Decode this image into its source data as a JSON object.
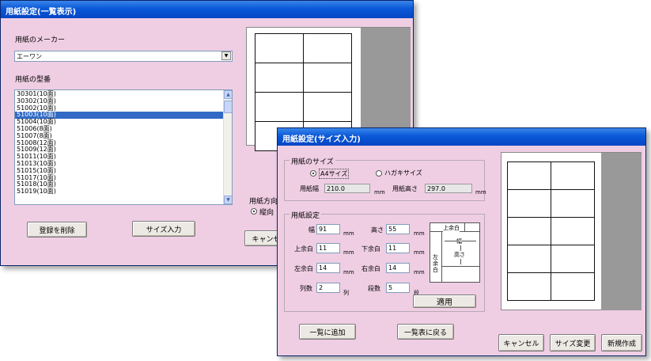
{
  "list_window": {
    "title": "用紙設定(一覧表示)",
    "maker_label": "用紙のメーカー",
    "maker_value": "エーワン",
    "model_label": "用紙の型番",
    "models": [
      "30301(10面)",
      "30302(10面)",
      "51002(10面)",
      "51003(10面)",
      "51004(10面)",
      "51006(8面)",
      "51007(8面)",
      "51008(12面)",
      "51009(12面)",
      "51011(10面)",
      "51013(10面)",
      "51015(10面)",
      "51017(10面)",
      "51018(10面)",
      "51019(10面)"
    ],
    "selected_model": "51003(10面)",
    "delete_button": "登録を削除",
    "size_input_button": "サイズ入力",
    "orientation_label": "用紙方向",
    "orientation_value": "縦向",
    "cancel_button": "キャンセル"
  },
  "size_window": {
    "title": "用紙設定(サイズ入力)",
    "paper_size_group": "用紙のサイズ",
    "radio_a4": "A4サイズ",
    "radio_hagaki": "ハガキサイズ",
    "paper_width_label": "用紙幅",
    "paper_width_value": "210.0",
    "paper_height_label": "用紙高さ",
    "paper_height_value": "297.0",
    "unit_mm": "mm",
    "settings_group": "用紙設定",
    "width_label": "幅",
    "width_value": "91",
    "height_label": "高さ",
    "height_value": "55",
    "top_margin_label": "上余白",
    "top_margin_value": "11",
    "bottom_margin_label": "下余白",
    "bottom_margin_value": "11",
    "left_margin_label": "左余白",
    "left_margin_value": "14",
    "right_margin_label": "右余白",
    "right_margin_value": "14",
    "columns_label": "列数",
    "columns_value": "2",
    "columns_unit": "列",
    "rows_label": "段数",
    "rows_value": "5",
    "rows_unit": "段",
    "diagram": {
      "top": "上余白",
      "width": "幅",
      "height": "高さ",
      "left_1": "左",
      "left_2": "余",
      "left_3": "白"
    },
    "apply_button": "適用",
    "add_to_list_button": "一覧に追加",
    "back_to_list_button": "一覧表に戻る",
    "cancel_button": "キャンセル",
    "change_size_button": "サイズ変更",
    "new_button": "新規作成"
  },
  "colors": {
    "title_bar": "#0a58d8",
    "dialog_bg": "#efcee4",
    "selection": "#316ac5"
  },
  "icons": {
    "dropdown": "chevron-down-icon",
    "scroll_up": "chevron-up-icon",
    "scroll_down": "chevron-down-icon"
  }
}
